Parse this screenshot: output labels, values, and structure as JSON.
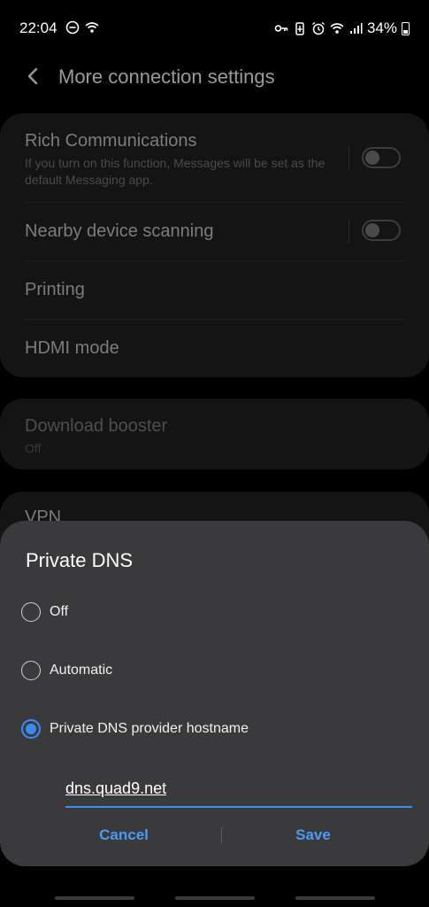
{
  "status_bar": {
    "time": "22:04",
    "battery": "34%",
    "left_icons": [
      "do-not-disturb-icon",
      "wifi-calling-icon"
    ],
    "right_icons": [
      "key-icon",
      "battery-saver-icon",
      "alarm-icon",
      "wifi-icon",
      "signal-icon"
    ]
  },
  "header": {
    "title": "More connection settings"
  },
  "settings": {
    "rich_communications": {
      "title": "Rich Communications",
      "subtitle": "If you turn on this function, Messages will be set as the default Messaging app.",
      "enabled": false
    },
    "nearby_scanning": {
      "title": "Nearby device scanning",
      "enabled": false
    },
    "printing": {
      "title": "Printing"
    },
    "hdmi": {
      "title": "HDMI mode"
    },
    "download_booster": {
      "title": "Download booster",
      "value": "Off"
    },
    "vpn": {
      "title": "VPN"
    }
  },
  "dialog": {
    "title": "Private DNS",
    "options": [
      {
        "label": "Off",
        "selected": false
      },
      {
        "label": "Automatic",
        "selected": false
      },
      {
        "label": "Private DNS provider hostname",
        "selected": true
      }
    ],
    "hostname_value": "dns.quad9.net",
    "cancel_label": "Cancel",
    "save_label": "Save"
  },
  "colors": {
    "accent": "#3a8df0",
    "dialog_bg": "#3a3a3c",
    "background": "#000000"
  }
}
